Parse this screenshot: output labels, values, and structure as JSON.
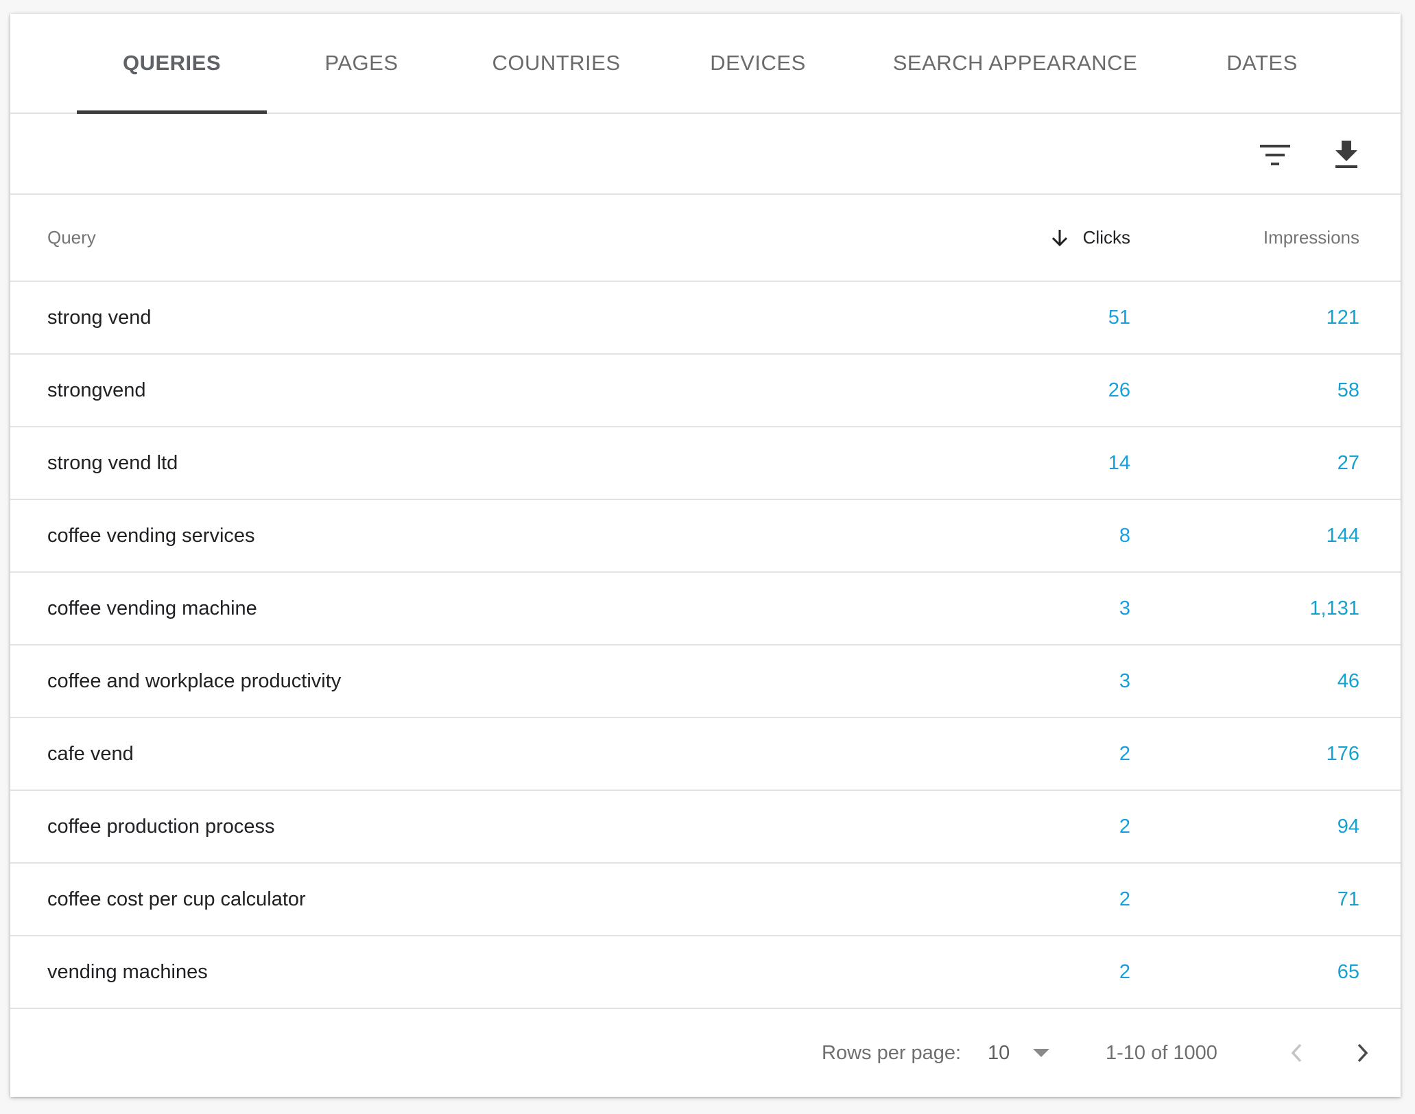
{
  "tabs": [
    {
      "label": "QUERIES",
      "active": true
    },
    {
      "label": "PAGES",
      "active": false
    },
    {
      "label": "COUNTRIES",
      "active": false
    },
    {
      "label": "DEVICES",
      "active": false
    },
    {
      "label": "SEARCH APPEARANCE",
      "active": false
    },
    {
      "label": "DATES",
      "active": false
    }
  ],
  "toolbar": {
    "filter_icon": "filter-icon",
    "download_icon": "download-icon"
  },
  "table": {
    "columns": {
      "query": "Query",
      "clicks": "Clicks",
      "impressions": "Impressions"
    },
    "sort": {
      "column": "clicks",
      "direction": "descending"
    },
    "rows": [
      {
        "query": "strong vend",
        "clicks": "51",
        "impressions": "121"
      },
      {
        "query": "strongvend",
        "clicks": "26",
        "impressions": "58"
      },
      {
        "query": "strong vend ltd",
        "clicks": "14",
        "impressions": "27"
      },
      {
        "query": "coffee vending services",
        "clicks": "8",
        "impressions": "144"
      },
      {
        "query": "coffee vending machine",
        "clicks": "3",
        "impressions": "1,131"
      },
      {
        "query": "coffee and workplace productivity",
        "clicks": "3",
        "impressions": "46"
      },
      {
        "query": "cafe vend",
        "clicks": "2",
        "impressions": "176"
      },
      {
        "query": "coffee production process",
        "clicks": "2",
        "impressions": "94"
      },
      {
        "query": "coffee cost per cup calculator",
        "clicks": "2",
        "impressions": "71"
      },
      {
        "query": "vending machines",
        "clicks": "2",
        "impressions": "65"
      }
    ]
  },
  "pagination": {
    "rows_per_page_label": "Rows per page:",
    "rows_per_page_value": "10",
    "range_text": "1-10 of 1000"
  },
  "colors": {
    "clicks_value": "#1a9fdd",
    "impressions_value": "#16a2cf",
    "active_tab_ink": "#3c3c3c"
  }
}
